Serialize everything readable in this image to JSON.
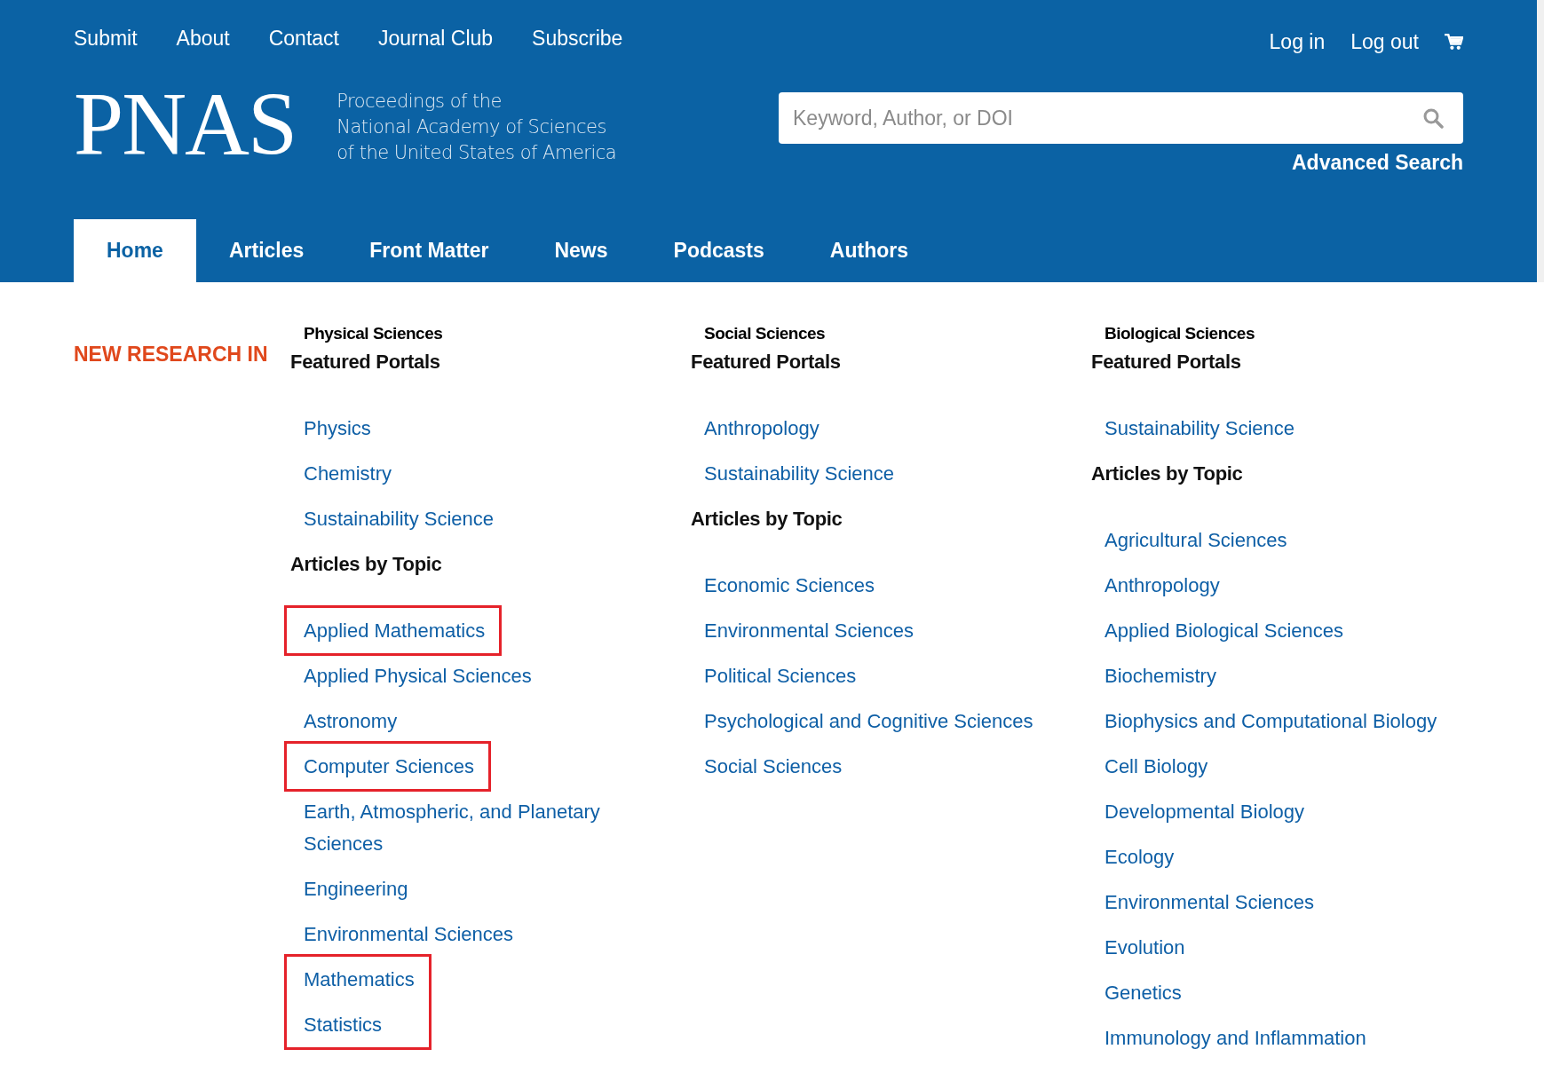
{
  "top_links": [
    "Submit",
    "About",
    "Contact",
    "Journal Club",
    "Subscribe"
  ],
  "account_links": [
    "Log in",
    "Log out"
  ],
  "logo": {
    "wordmark": "PNAS",
    "subtitle": [
      "Proceedings of the",
      "National Academy of Sciences",
      "of the United States of America"
    ]
  },
  "search": {
    "placeholder": "Keyword, Author, or DOI"
  },
  "advanced_search": "Advanced Search",
  "tabs": [
    {
      "label": "Home",
      "selected": true
    },
    {
      "label": "Articles",
      "selected": false
    },
    {
      "label": "Front Matter",
      "selected": false
    },
    {
      "label": "News",
      "selected": false
    },
    {
      "label": "Podcasts",
      "selected": false
    },
    {
      "label": "Authors",
      "selected": false
    }
  ],
  "section_label": "NEW RESEARCH IN",
  "columns": [
    {
      "title": "Physical Sciences",
      "groups": [
        {
          "heading": "Featured Portals",
          "links": [
            {
              "label": "Physics",
              "highlighted": false
            },
            {
              "label": "Chemistry",
              "highlighted": false
            },
            {
              "label": "Sustainability Science",
              "highlighted": false
            }
          ]
        },
        {
          "heading": "Articles by Topic",
          "links": [
            {
              "label": "Applied Mathematics",
              "highlighted": true
            },
            {
              "label": "Applied Physical Sciences",
              "highlighted": false
            },
            {
              "label": "Astronomy",
              "highlighted": false
            },
            {
              "label": "Computer Sciences",
              "highlighted": true
            },
            {
              "label": "Earth, Atmospheric, and Planetary Sciences",
              "highlighted": false
            },
            {
              "label": "Engineering",
              "highlighted": false
            },
            {
              "label": "Environmental Sciences",
              "highlighted": false
            },
            {
              "label": "Mathematics",
              "highlighted": true
            },
            {
              "label": "Statistics",
              "highlighted": true
            }
          ]
        }
      ]
    },
    {
      "title": "Social Sciences",
      "groups": [
        {
          "heading": "Featured Portals",
          "links": [
            {
              "label": "Anthropology",
              "highlighted": false
            },
            {
              "label": "Sustainability Science",
              "highlighted": false
            }
          ]
        },
        {
          "heading": "Articles by Topic",
          "links": [
            {
              "label": "Economic Sciences",
              "highlighted": false
            },
            {
              "label": "Environmental Sciences",
              "highlighted": false
            },
            {
              "label": "Political Sciences",
              "highlighted": false
            },
            {
              "label": "Psychological and Cognitive Sciences",
              "highlighted": false
            },
            {
              "label": "Social Sciences",
              "highlighted": false
            }
          ]
        }
      ]
    },
    {
      "title": "Biological Sciences",
      "groups": [
        {
          "heading": "Featured Portals",
          "links": [
            {
              "label": "Sustainability Science",
              "highlighted": false
            }
          ]
        },
        {
          "heading": "Articles by Topic",
          "links": [
            {
              "label": "Agricultural Sciences",
              "highlighted": false
            },
            {
              "label": "Anthropology",
              "highlighted": false
            },
            {
              "label": "Applied Biological Sciences",
              "highlighted": false
            },
            {
              "label": "Biochemistry",
              "highlighted": false
            },
            {
              "label": "Biophysics and Computational Biology",
              "highlighted": false
            },
            {
              "label": "Cell Biology",
              "highlighted": false
            },
            {
              "label": "Developmental Biology",
              "highlighted": false
            },
            {
              "label": "Ecology",
              "highlighted": false
            },
            {
              "label": "Environmental Sciences",
              "highlighted": false
            },
            {
              "label": "Evolution",
              "highlighted": false
            },
            {
              "label": "Genetics",
              "highlighted": false
            },
            {
              "label": "Immunology and Inflammation",
              "highlighted": false
            }
          ]
        }
      ]
    }
  ]
}
